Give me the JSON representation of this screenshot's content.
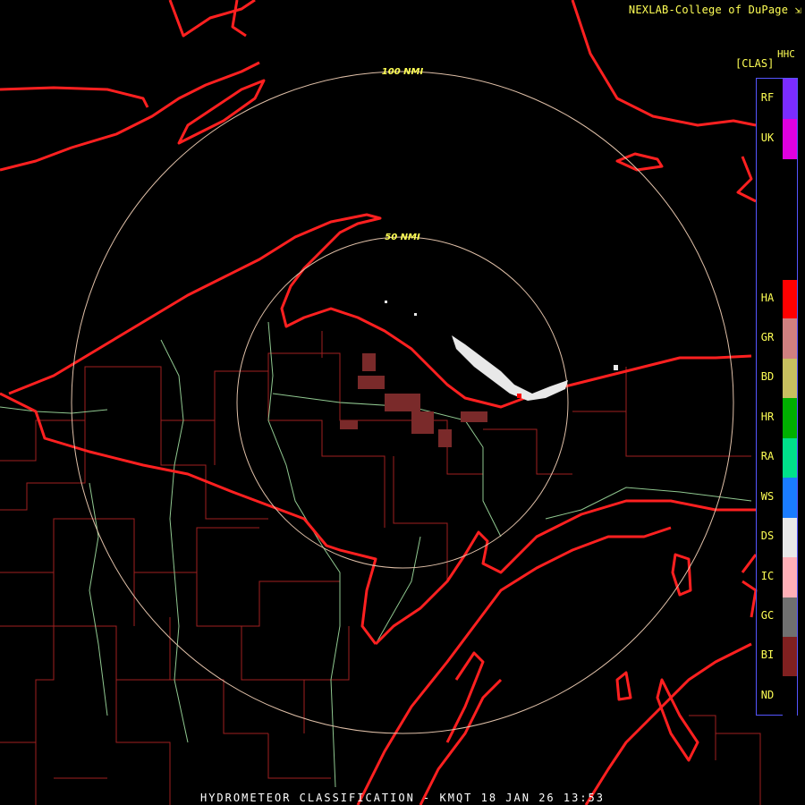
{
  "credit": "NEXLAB-College of DuPage",
  "footer": "HYDROMETEOR CLASSIFICATION - KMQT 18 JAN 26 13:53",
  "range_rings": [
    "100 NMI",
    "50 NMI"
  ],
  "legend": {
    "title_line1": "HHC",
    "title_line2": "[CLAS]",
    "classes": [
      {
        "code": "RF",
        "color": "#7b2cff"
      },
      {
        "code": "UK",
        "color": "#e000e0"
      },
      {
        "code": "HA",
        "color": "#ff0000"
      },
      {
        "code": "GR",
        "color": "#d08080"
      },
      {
        "code": "BD",
        "color": "#c8c060"
      },
      {
        "code": "HR",
        "color": "#00b000"
      },
      {
        "code": "RA",
        "color": "#00e08a"
      },
      {
        "code": "WS",
        "color": "#1a7cff"
      },
      {
        "code": "DS",
        "color": "#e8e8e8"
      },
      {
        "code": "IC",
        "color": "#ffb0b8"
      },
      {
        "code": "GC",
        "color": "#707070"
      },
      {
        "code": "BI",
        "color": "#802020"
      },
      {
        "code": "ND",
        "color": "#000000"
      }
    ]
  },
  "colors": {
    "coast": "#ff2020",
    "county": "#a02020",
    "river": "#90c890",
    "ring": "#e0c0a8",
    "label": "#ffff55"
  }
}
